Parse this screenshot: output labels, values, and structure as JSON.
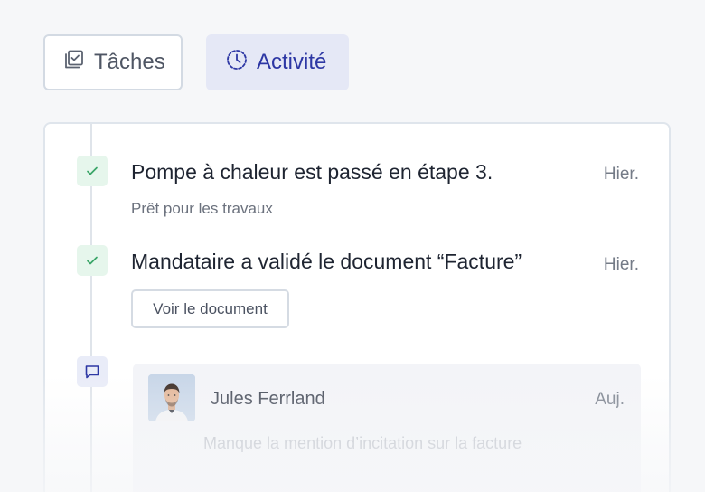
{
  "tabs": [
    {
      "label": "Tâches",
      "icon": "checkbox-list-icon",
      "active": false
    },
    {
      "label": "Activité",
      "icon": "clock-icon",
      "active": true
    }
  ],
  "timeline": {
    "events": [
      {
        "icon": "check-icon",
        "title": "Pompe à chaleur est passé en étape 3.",
        "time": "Hier.",
        "subtitle": "Prêt pour les travaux"
      },
      {
        "icon": "check-icon",
        "title": "Mandataire a validé le document “Facture”",
        "time": "Hier.",
        "button_label": "Voir le document"
      },
      {
        "icon": "comment-icon",
        "comment": {
          "author": "Jules Ferrland",
          "time": "Auj.",
          "text": "Manque la mention d’incitation sur la facture"
        }
      }
    ]
  },
  "colors": {
    "accent": "#2d37a4",
    "success": "#3aa568",
    "background": "#f6f7f9"
  }
}
